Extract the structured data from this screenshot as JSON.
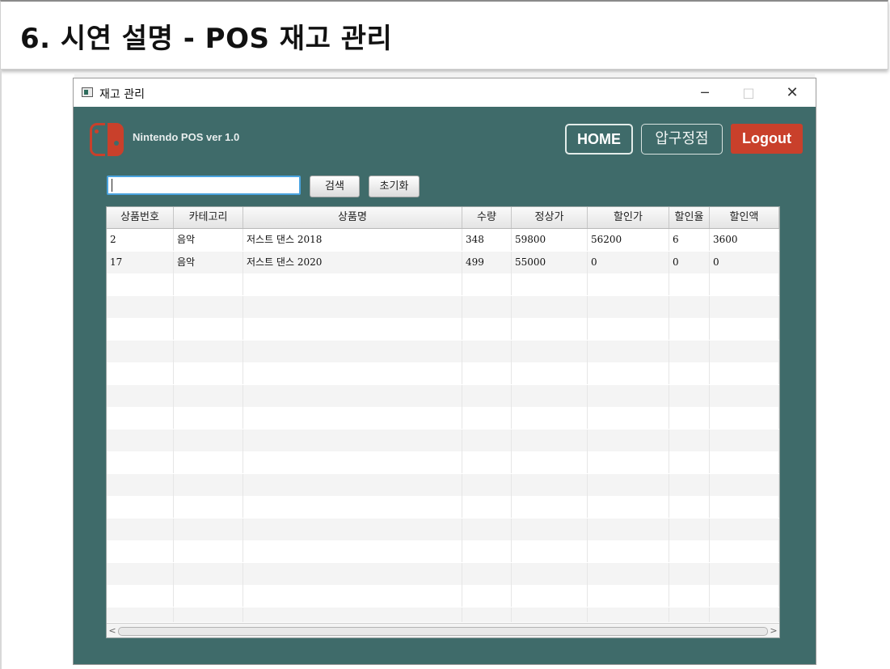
{
  "slide": {
    "title": "6. 시연 설명 - POS 재고 관리"
  },
  "window": {
    "title": "재고 관리",
    "controls": {
      "minimize": "─",
      "maximize": "□",
      "close": "✕"
    }
  },
  "app": {
    "name": "Nintendo POS ver 1.0",
    "nav": {
      "home": "HOME",
      "store": "압구정점",
      "logout": "Logout"
    },
    "colors": {
      "background": "#3f6b6a",
      "accent": "#c9402b"
    }
  },
  "search": {
    "value": "",
    "search_button": "검색",
    "reset_button": "초기화"
  },
  "table": {
    "columns": [
      "상품번호",
      "카테고리",
      "상품명",
      "수량",
      "정상가",
      "할인가",
      "할인율",
      "할인액"
    ],
    "rows": [
      [
        "2",
        "음악",
        "저스트 댄스 2018",
        "348",
        "59800",
        "56200",
        "6",
        "3600"
      ],
      [
        "17",
        "음악",
        "저스트 댄스 2020",
        "499",
        "55000",
        "0",
        "0",
        "0"
      ]
    ]
  },
  "scrollbar": {
    "left_arrow": "<",
    "right_arrow": ">"
  }
}
